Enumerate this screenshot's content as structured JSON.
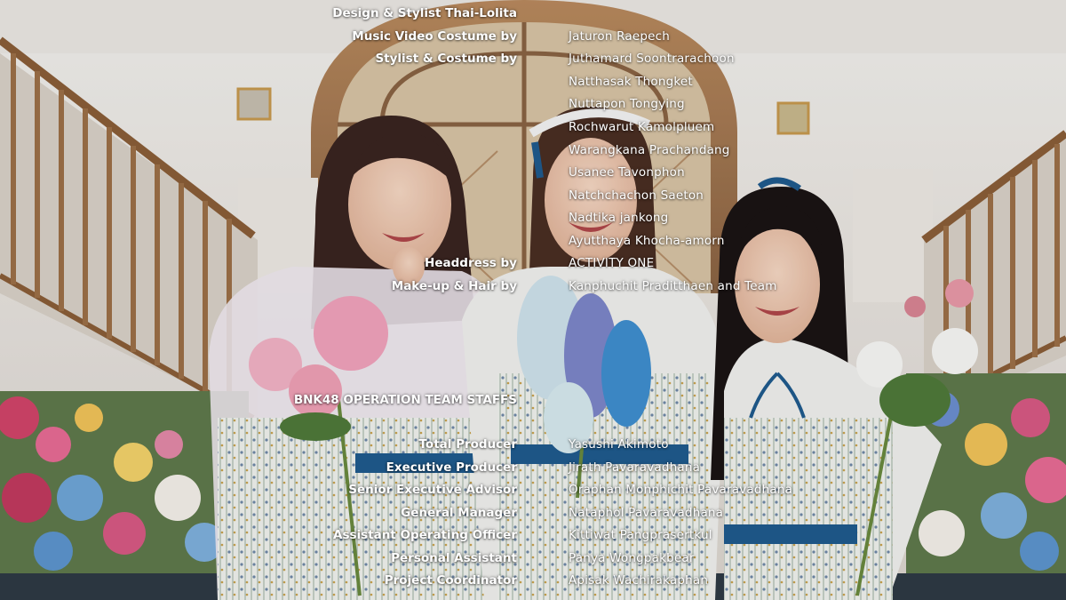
{
  "credits_top": [
    {
      "role": "Design & Stylist Thai-Lolita",
      "names": []
    },
    {
      "role": "Music Video Costume by",
      "names": [
        "Jaturon Raepech"
      ]
    },
    {
      "role": "Stylist & Costume by",
      "names": [
        "Juthamard Soontrarachoon",
        "Natthasak Thongket",
        "Nuttapon Tongying",
        "Rochwarut Kamolpluem",
        "Warangkana Prachandang",
        "Usanee Tavonphon",
        "Natchchachon Saeton",
        "Nadtika jankong",
        "Ayutthaya Khocha-amorn"
      ]
    },
    {
      "role": "Headdress by",
      "names": [
        "ACTIVITY ONE"
      ]
    },
    {
      "role": "Make-up & Hair by",
      "names": [
        "Kanphuchit Praditthaen and Team"
      ]
    }
  ],
  "section_heading": "BNK48 OPERATION TEAM STAFFS",
  "credits_bottom": [
    {
      "role": "Total Producer",
      "names": [
        "Yasushi Akimoto"
      ]
    },
    {
      "role": "Executive Producer",
      "names": [
        "Jirath Pavaravadhana"
      ]
    },
    {
      "role": "Senior Executive Advisor",
      "names": [
        "Oraphan Monphichit Pavaravadhana"
      ]
    },
    {
      "role": "General Manager",
      "names": [
        "Nataphol Pavaravadhana"
      ]
    },
    {
      "role": "Assistant Operating Officer",
      "names": [
        "Kittiwat Pangprasertkul"
      ]
    },
    {
      "role": "Personal Assistant",
      "names": [
        "Panya Wongpakbear"
      ]
    },
    {
      "role": "Project Coordinator",
      "names": [
        "Apisak Wachirakaphan"
      ]
    }
  ]
}
